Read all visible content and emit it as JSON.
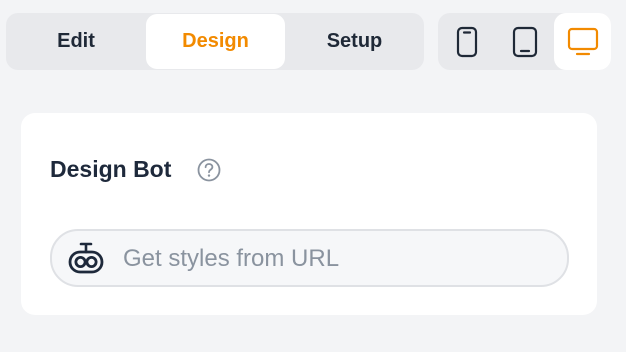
{
  "tabs": {
    "edit": "Edit",
    "design": "Design",
    "setup": "Setup",
    "active": "Design",
    "active_color": "#f28a00"
  },
  "device_toggle": {
    "items": [
      "phone-icon",
      "tablet-icon",
      "desktop-icon"
    ],
    "selected": "desktop-icon",
    "selected_color": "#f28a00"
  },
  "design_bot": {
    "title": "Design Bot",
    "help_icon": "question-circle-icon",
    "input_icon": "bot-icon",
    "placeholder": "Get styles from URL"
  }
}
